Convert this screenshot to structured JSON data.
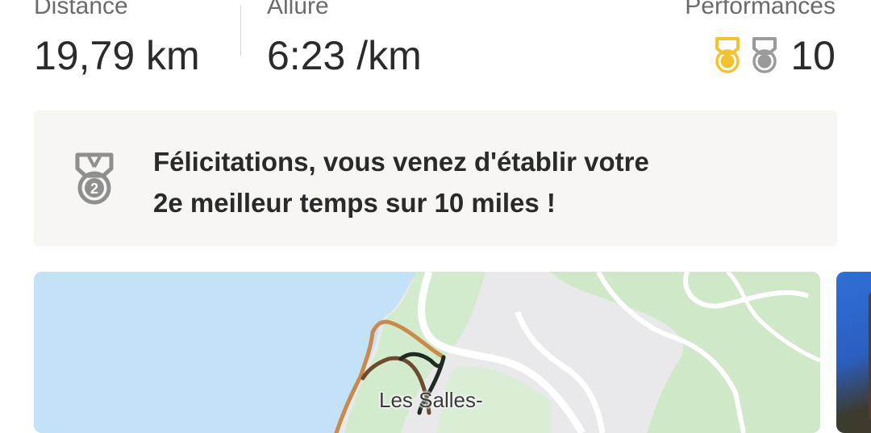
{
  "stats": {
    "distance": {
      "label": "Distance",
      "value": "19,79 km"
    },
    "allure": {
      "label": "Allure",
      "value": "6:23 /km"
    },
    "performances": {
      "label": "Performances",
      "count": "10",
      "medals": [
        {
          "icon": "gold-medal-icon",
          "color": "#f2c230"
        },
        {
          "icon": "silver-medal-icon",
          "color": "#9a9a9a"
        }
      ]
    }
  },
  "banner": {
    "icon": "silver-medal-2-icon",
    "medal_number": "2",
    "line1": "Félicitations, vous venez d'établir votre",
    "line2": "2e meilleur temps sur 10 miles !"
  },
  "map": {
    "place_label": "Les Salles-",
    "colors": {
      "water": "#c3e2f7",
      "land": "#e9e9ec",
      "green": "#cfe8c8",
      "route_start": "#c98a4b",
      "route_end": "#1f2a22"
    }
  }
}
